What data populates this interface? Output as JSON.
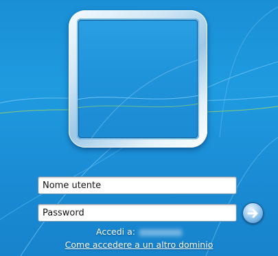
{
  "login": {
    "username_placeholder": "Nome utente",
    "password_placeholder": "Password",
    "signin_label": "Accedi a:",
    "other_domain_link": "Come accedere a un altro dominio"
  },
  "colors": {
    "background": "#1a8fd6",
    "frame": "#cfe6f5",
    "text": "#ffffff"
  },
  "icons": {
    "submit": "arrow-right-icon"
  }
}
